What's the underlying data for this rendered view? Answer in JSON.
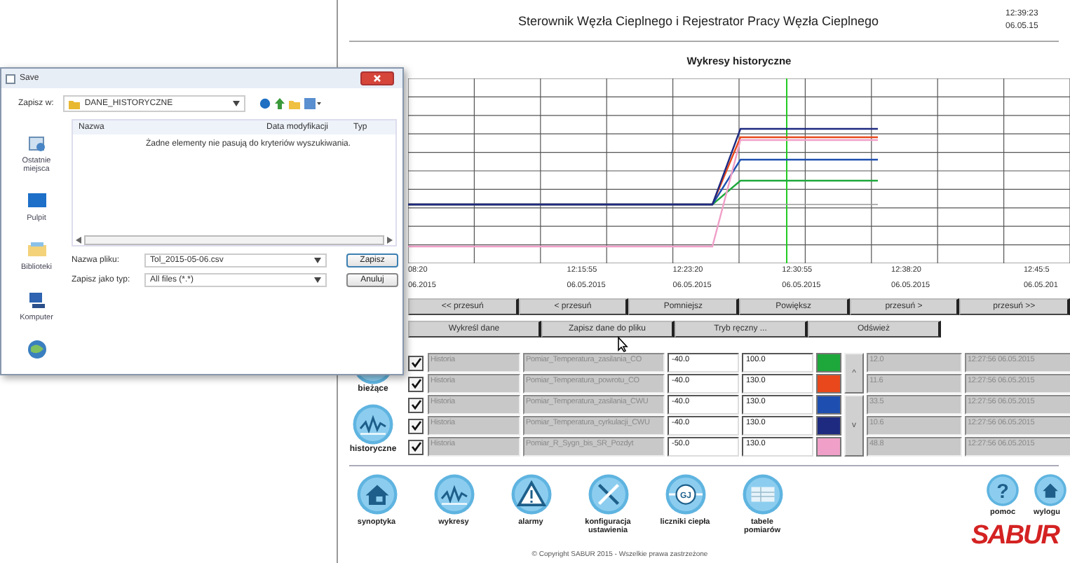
{
  "dialog": {
    "title": "Save",
    "save_in_label": "Zapisz w:",
    "folder": "DANE_HISTORYCZNE",
    "places": [
      {
        "label": "Ostatnie miejsca",
        "kind": "recent"
      },
      {
        "label": "Pulpit",
        "kind": "desktop"
      },
      {
        "label": "Biblioteki",
        "kind": "libraries"
      },
      {
        "label": "Komputer",
        "kind": "computer"
      },
      {
        "kind": "network"
      }
    ],
    "columns": [
      "Nazwa",
      "Data modyfikacji",
      "Typ"
    ],
    "empty_message": "Żadne elementy nie pasują do kryteriów wyszukiwania.",
    "filename_label": "Nazwa pliku:",
    "filename": "Tol_2015-05-06.csv",
    "filetype_label": "Zapisz jako typ:",
    "filetype": "All files (*.*)",
    "buttons": [
      "Zapisz",
      "Anuluj"
    ]
  },
  "header": {
    "title": "Sterownik Węzła Cieplnego i Rejestrator Pracy Węzła Cieplnego",
    "time": "12:39:23",
    "date": "06.05.15"
  },
  "chart": {
    "title": "Wykresy historyczne",
    "x_ticks": [
      {
        "time": "08:20",
        "date": "06.2015"
      },
      {
        "time": "12:15:55",
        "date": "06.05.2015"
      },
      {
        "time": "12:23:20",
        "date": "06.05.2015"
      },
      {
        "time": "12:30:55",
        "date": "06.05.2015"
      },
      {
        "time": "12:38:20",
        "date": "06.05.2015"
      },
      {
        "time": "12:45:5",
        "date": "06.05.201"
      }
    ]
  },
  "nav_buttons": [
    "<< przesuń",
    "< przesuń",
    "Pomniejsz",
    "Powiększ",
    "przesuń >",
    "przesuń >>"
  ],
  "action_buttons": [
    "Wykreśl dane",
    "Zapisz dane do pliku",
    "Tryb ręczny ...",
    "Odśwież"
  ],
  "channels": [
    {
      "checked": true,
      "name": "Historia",
      "signal": "Pomiar_Temperatura_zasilania_CO",
      "min": "-40.0",
      "max": "100.0",
      "color": "#1ea83c",
      "value": "12.0",
      "timestamp": "12:27:56 06.05.2015"
    },
    {
      "checked": true,
      "name": "Historia",
      "signal": "Pomiar_Temperatura_powrotu_CO",
      "min": "-40.0",
      "max": "130.0",
      "color": "#e8481c",
      "value": "11.6",
      "timestamp": "12:27:56 06.05.2015"
    },
    {
      "checked": true,
      "name": "Historia",
      "signal": "Pomiar_Temperatura_zasilania_CWU",
      "min": "-40.0",
      "max": "130.0",
      "color": "#1e4fb0",
      "value": "33.5",
      "timestamp": "12:27:56 06.05.2015"
    },
    {
      "checked": true,
      "name": "Historia",
      "signal": "Pomiar_Temperatura_cyrkulacji_CWU",
      "min": "-40.0",
      "max": "130.0",
      "color": "#1e2a80",
      "value": "10.6",
      "timestamp": "12:27:56 06.05.2015"
    },
    {
      "checked": true,
      "name": "Historia",
      "signal": "Pomiar_R_Sygn_bis_SR_Pozdyt",
      "min": "-50.0",
      "max": "130.0",
      "color": "#f0a0c8",
      "value": "48.8",
      "timestamp": "12:27:56 06.05.2015"
    }
  ],
  "scroll_buttons": [
    "^",
    "v"
  ],
  "sidebar": [
    {
      "label": "bieżące",
      "kind": "current"
    },
    {
      "label": "historyczne",
      "kind": "history"
    }
  ],
  "bottom_nav": [
    {
      "label": "synoptyka",
      "kind": "house"
    },
    {
      "label": "wykresy",
      "kind": "chart"
    },
    {
      "label": "alarmy",
      "kind": "alarm"
    },
    {
      "label": "konfiguracja ustawienia",
      "kind": "tools"
    },
    {
      "label": "liczniki ciepła",
      "kind": "meter",
      "glyph": "GJ"
    },
    {
      "label": "tabele pomiarów",
      "kind": "table"
    }
  ],
  "help": {
    "label": "pomoc",
    "glyph": "?"
  },
  "logout": {
    "label": "wylogu"
  },
  "logo": "SABUR",
  "copyright": "© Copyright SABUR 2015 - Wszelkie prawa zastrzeżone"
}
